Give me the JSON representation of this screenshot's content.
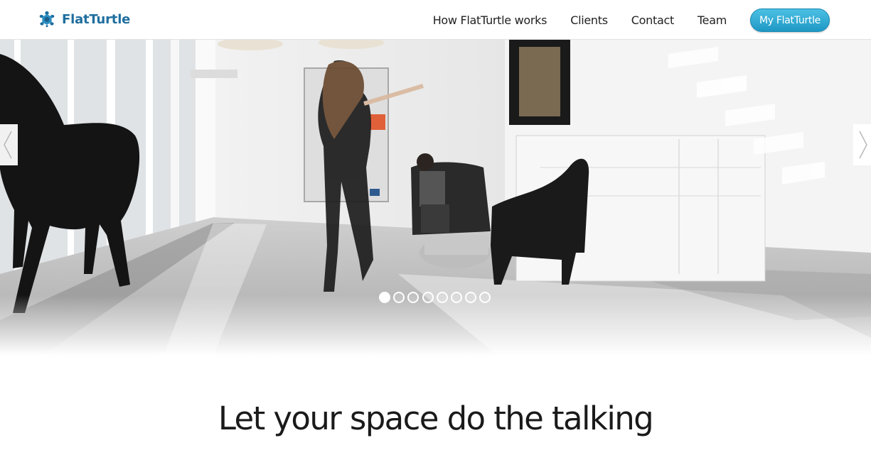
{
  "header": {
    "logo": {
      "icon": "turtle-icon",
      "text": "FlatTurtle",
      "color": "#1f6e9e"
    },
    "nav": [
      {
        "label": "How FlatTurtle works"
      },
      {
        "label": "Clients"
      },
      {
        "label": "Contact"
      },
      {
        "label": "Team"
      }
    ],
    "cta": {
      "label": "My FlatTurtle",
      "color": "#2aa6d3"
    }
  },
  "hero": {
    "prev_icon": "chevron-left-icon",
    "next_icon": "chevron-right-icon",
    "slide_count": 8,
    "active_slide": 1
  },
  "main": {
    "tagline": "Let your space do the talking"
  }
}
